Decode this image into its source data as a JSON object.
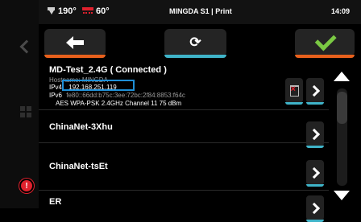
{
  "status": {
    "nozzle_temp": "190°",
    "bed_temp": "60°",
    "title": "MINGDA S1 | Print",
    "time": "14:09"
  },
  "toolbar": {
    "back_icon": "arrow-left-icon",
    "refresh_icon": "refresh-icon",
    "refresh_glyph": "C",
    "confirm_icon": "check-icon"
  },
  "colors": {
    "accent_orange": "#e8601c",
    "accent_cyan": "#3fb4c9",
    "check_green": "#7ac943",
    "ip_highlight": "#1f8fd6",
    "alert_red": "#e0212d"
  },
  "networks": [
    {
      "ssid": "MD-Test_2.4G ( Connected )",
      "hostname": "Hostname: MINGDA",
      "ipv4_label": "IPv4",
      "ipv4": "192.168.251.119",
      "ipv6_label": "IPv6",
      "ipv6": "fe80::66dd:b75c:3ee:72bc:2f84:8853:f64c",
      "info": "AES WPA-PSK  2.4GHz Channel 11 75 dBm"
    },
    {
      "ssid": "ChinaNet-3Xhu"
    },
    {
      "ssid": "ChinaNet-tsEt"
    },
    {
      "ssid": "ER"
    }
  ]
}
